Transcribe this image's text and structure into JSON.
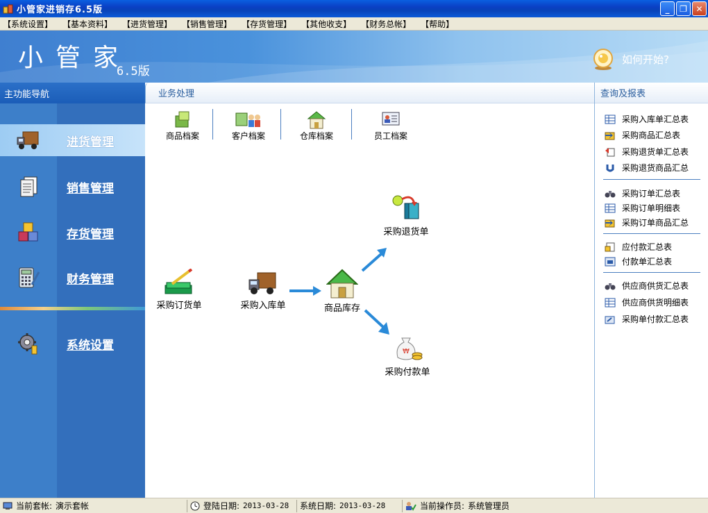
{
  "window": {
    "title": "小管家进销存6.5版",
    "buttons": [
      "_",
      "❐",
      "✕"
    ]
  },
  "menu": [
    "【系统设置】",
    "【基本资料】",
    "【进货管理】",
    "【销售管理】",
    "【存货管理】",
    "【其他收支】",
    "【财务总帐】",
    "【帮助】"
  ],
  "banner": {
    "brand": "小管家",
    "version": "6.5版",
    "help_label": "如何开始?"
  },
  "leftnav": {
    "header": "主功能导航",
    "items": [
      {
        "label": "进货管理",
        "icon": "truck-icon",
        "active": true
      },
      {
        "label": "销售管理",
        "icon": "documents-icon",
        "active": false
      },
      {
        "label": "存货管理",
        "icon": "boxes-icon",
        "active": false
      },
      {
        "label": "财务管理",
        "icon": "calculator-icon",
        "active": false
      },
      {
        "label": "系统设置",
        "icon": "gear-icon",
        "active": false
      }
    ]
  },
  "center": {
    "header": "业务处理",
    "quick": [
      {
        "label": "商品档案",
        "icon": "goods-icon"
      },
      {
        "label": "客户档案",
        "icon": "customers-icon"
      },
      {
        "label": "仓库档案",
        "icon": "warehouse-icon"
      },
      {
        "label": "员工档案",
        "icon": "employee-card-icon"
      }
    ],
    "flow": {
      "order": "采购订货单",
      "inbound": "采购入库单",
      "stock": "商品库存",
      "return": "采购退货单",
      "payment": "采购付款单"
    }
  },
  "right": {
    "header": "查询及报表",
    "groups": [
      [
        "采购入库单汇总表",
        "采购商品汇总表",
        "采购退货单汇总表",
        "采购退货商品汇总"
      ],
      [
        "采购订单汇总表",
        "采购订单明细表",
        "采购订单商品汇总"
      ],
      [
        "应付款汇总表",
        "付款单汇总表"
      ],
      [
        "供应商供货汇总表",
        "供应商供货明细表",
        "采购单付款汇总表"
      ]
    ]
  },
  "status": {
    "account_label": "当前套帐:",
    "account": "演示套帐",
    "login_label": "登陆日期:",
    "login_date": "2013-03-28",
    "system_label": "系统日期:",
    "system_date": "2013-03-28",
    "operator_label": "当前操作员:",
    "operator": "系统管理员"
  }
}
